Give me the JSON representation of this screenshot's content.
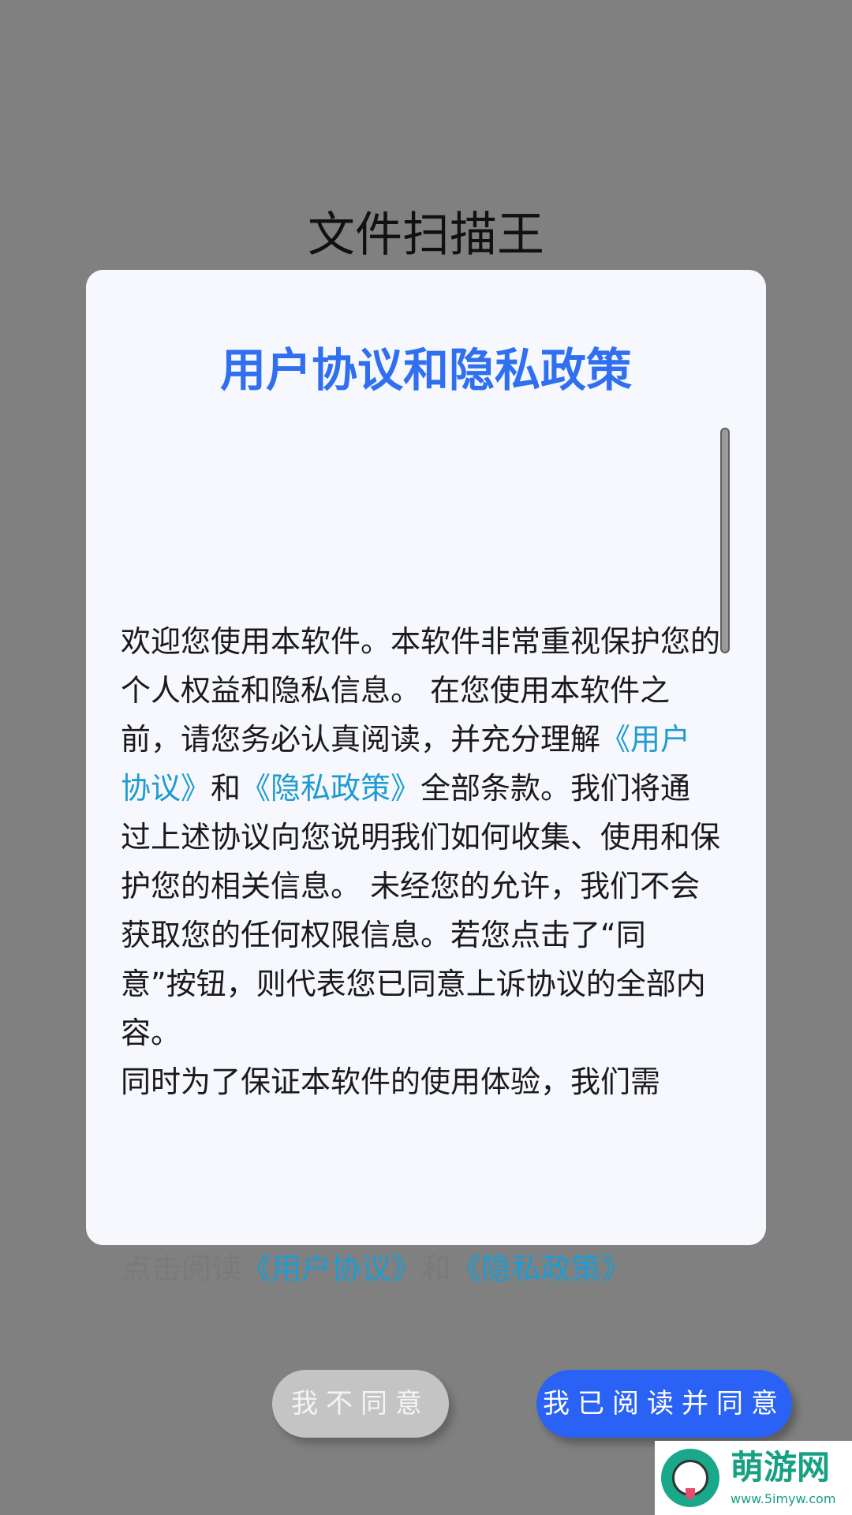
{
  "app": {
    "title": "文件扫描王"
  },
  "dialog": {
    "title": "用户协议和隐私政策",
    "body": {
      "p1_a": "欢迎您使用本软件。本软件非常重视保护您的个人权益和隐私信息。 在您使用本软件之前，请您务必认真阅读，并充分理解",
      "p1_link_user": "《用户协议》",
      "p1_and": "和",
      "p1_link_privacy": "《隐私政策》",
      "p1_b": "全部条款。我们将通过上述协议向您说明我们如何收集、使用和保护您的相关信息。 未经您的允许，我们不会获取您的任何权限信息。若您点击了“同意”按钮，则代表您已同意上诉协议的全部内容。",
      "p2": " 同时为了保证本软件的使用体验，我们需"
    },
    "consent": {
      "prefix": "点击阅读",
      "link_user": "《用户协议》",
      "and": "和",
      "link_privacy": "《隐私政策》"
    },
    "buttons": {
      "disagree": "我不同意",
      "agree": "我已阅读并同意"
    }
  },
  "watermark": {
    "name": "萌游网",
    "url": "www.5imyw.com"
  },
  "colors": {
    "accent": "#2f6ff0",
    "link": "#1f9bd1",
    "agree_button": "#2b62f6",
    "disagree_button": "#c4c4c4",
    "backdrop": "#808080"
  }
}
